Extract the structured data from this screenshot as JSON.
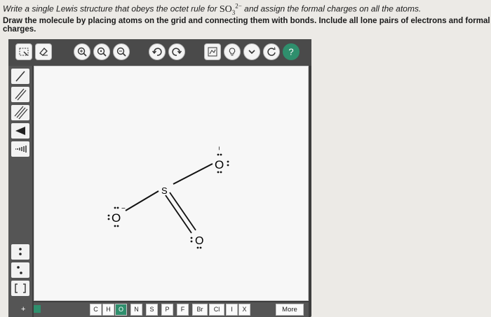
{
  "question": {
    "line1_prefix": "Write a single Lewis structure that obeys the octet rule for",
    "formula_main": "SO",
    "formula_sub": "3",
    "formula_sup": "2−",
    "line1_suffix": "and assign the formal charges on all the atoms.",
    "line2": "Draw the molecule by placing atoms on the grid and connecting them with bonds. Include all lone pairs of electrons and formal charges."
  },
  "toolbar": {
    "icons": [
      "select-lasso-icon",
      "eraser-icon",
      "zoom-in-icon",
      "zoom-reset-icon",
      "zoom-out-icon",
      "undo-icon",
      "redo-icon",
      "templates-icon",
      "hint-icon",
      "expand-icon",
      "clear-icon",
      "help-icon"
    ]
  },
  "sidebar": {
    "tools": [
      "single-bond-tool",
      "double-bond-tool",
      "triple-bond-tool",
      "wedge-bond-tool",
      "hash-bond-tool",
      "lone-pair-tool",
      "radical-tool",
      "bracket-tool"
    ],
    "charge_plus": "+"
  },
  "molecule": {
    "atoms": [
      {
        "symbol": "S",
        "charge": ""
      },
      {
        "symbol": "O",
        "charge": "−"
      },
      {
        "symbol": "O",
        "charge": "−"
      },
      {
        "symbol": "O",
        "charge": ""
      }
    ]
  },
  "elements": [
    "C",
    "H",
    "O",
    "N",
    "S",
    "P",
    "F",
    "Br",
    "Cl",
    "I",
    "X"
  ],
  "selected_element": "O",
  "more_label": "More",
  "colors": {
    "toolbar": "#4a4a4a",
    "sidebar": "#555555",
    "canvas": "#f7f7f7",
    "accent": "#2f8f6d"
  }
}
